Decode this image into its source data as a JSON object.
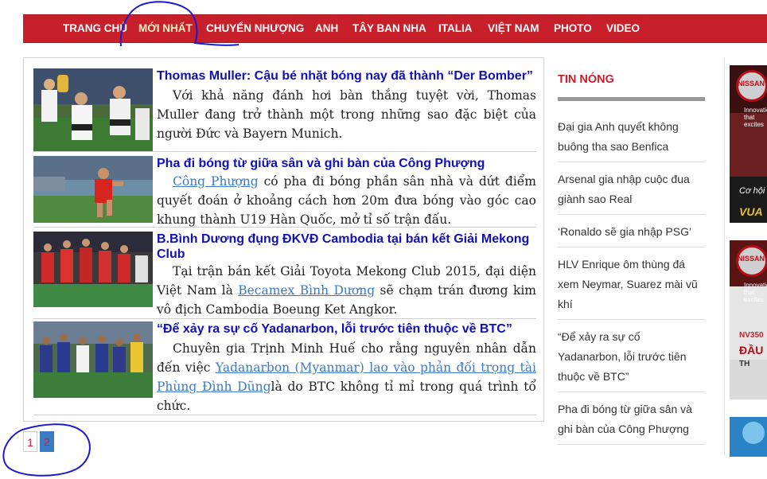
{
  "nav": {
    "items": [
      {
        "label": "TRANG CHỦ"
      },
      {
        "label": "MỚI NHẤT"
      },
      {
        "label": "CHUYỂN NHƯỢNG"
      },
      {
        "label": "ANH"
      },
      {
        "label": "TÂY BAN NHA"
      },
      {
        "label": "ITALIA"
      },
      {
        "label": "VIỆT NAM"
      },
      {
        "label": "PHOTO"
      },
      {
        "label": "VIDEO"
      }
    ]
  },
  "articles": [
    {
      "headline": "Thomas Muller: Cậu bé nhặt bóng nay đã thành “Der Bomber”",
      "summary": [
        {
          "text": "Với khả năng đánh hơi bàn thắng tuyệt vời, Thomas Muller đang trở thành một trong những sao đặc biệt của người Đức và Bayern Munich.",
          "link": false
        }
      ],
      "thumb": "thumb-muller-celebration"
    },
    {
      "headline": "Pha đi bóng từ giữa sân và ghi bàn của Công Phượng",
      "summary": [
        {
          "text": "Công Phượng",
          "link": true
        },
        {
          "text": " có pha đi bóng phần sân nhà và dứt điểm quyết đoán ở khoảng cách hơn 20m đưa bóng vào góc cao khung thành U19 Hàn Quốc, mở tỉ số trận đấu.",
          "link": false
        }
      ],
      "thumb": "thumb-cong-phuong"
    },
    {
      "headline": "B.Bình Dương đụng ĐKVĐ Cambodia tại bán kết Giải Mekong Club",
      "summary": [
        {
          "text": "Tại trận bán kết Giải Toyota Mekong Club 2015, đại diện Việt Nam là ",
          "link": false
        },
        {
          "text": "Becamex Bình Dương",
          "link": true
        },
        {
          "text": " sẽ chạm trán đương kim vô địch Cambodia Boeung Ket Angkor.",
          "link": false
        }
      ],
      "thumb": "thumb-binh-duong"
    },
    {
      "headline": "“Để xảy ra sự cố Yadanarbon, lỗi trước tiên thuộc về BTC”",
      "summary": [
        {
          "text": "Chuyên gia Trịnh Minh Huế cho rằng nguyên nhân dẫn đến việc ",
          "link": false
        },
        {
          "text": "Yadanarbon (Myanmar) lao vào phản đối trọng tài Phùng Đình Dũng",
          "link": true
        },
        {
          "text": "là do BTC không tỉ mỉ trong quá trình tổ chức.",
          "link": false
        }
      ],
      "thumb": "thumb-yadanarbon"
    }
  ],
  "pagination": {
    "pages": [
      "1",
      "2"
    ],
    "current": "2"
  },
  "sidebar": {
    "title": "TIN NÓNG",
    "items": [
      {
        "label": "Đại gia Anh quyết không buông tha sao Benfica"
      },
      {
        "label": "Arsenal gia nhập cuộc đua giành sao Real"
      },
      {
        "label": "‘Ronaldo sẽ gia nhập PSG’"
      },
      {
        "label": "HLV Enrique ôm thùng đá xem Neymar, Suarez mài vũ khí"
      },
      {
        "label": "“Để xảy ra sự cố Yadanarbon, lỗi trước tiên thuộc về BTC”"
      },
      {
        "label": "Pha đi bóng từ giữa sân và ghi bàn của Công Phượng"
      }
    ]
  },
  "ads": [
    {
      "brand": "NISSAN",
      "tagline": "Innovation that excites",
      "line1": "Cơ hội",
      "line2": "VUA"
    },
    {
      "brand": "NISSAN",
      "tagline": "Innovation that excites",
      "line1": "NV350",
      "line2": "ĐẦU",
      "line3": "TH"
    }
  ],
  "colors": {
    "nav_bg": "#c8202b",
    "headline": "#1010b8",
    "link": "#3a7bc4",
    "accent": "#c8202b",
    "annotation": "#1a1ad0"
  }
}
